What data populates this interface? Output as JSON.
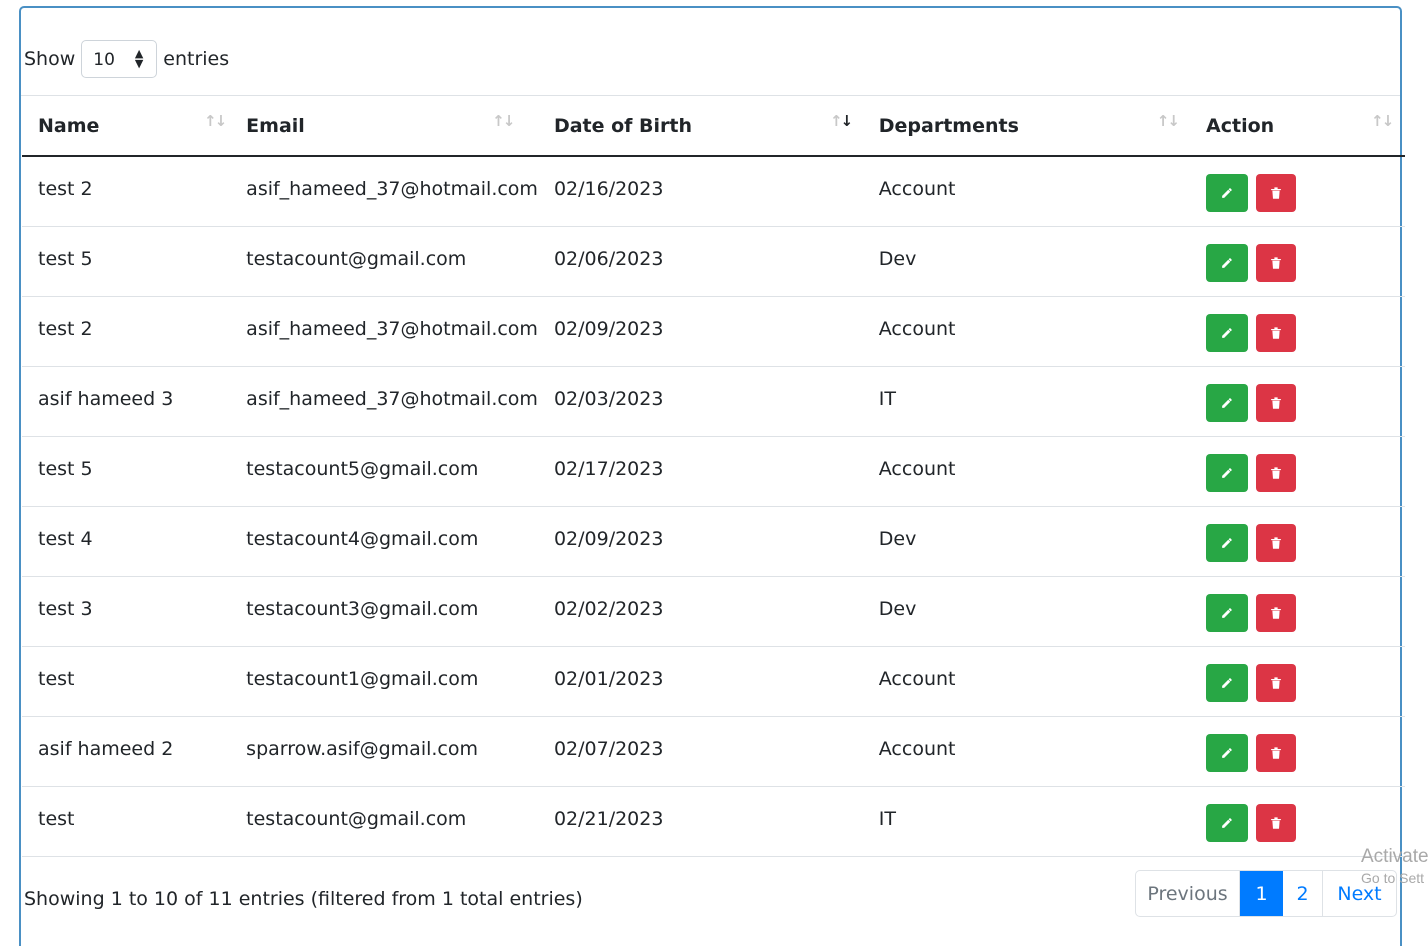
{
  "length_menu": {
    "prefix": "Show",
    "value": "10",
    "suffix": "entries"
  },
  "columns": [
    "Name",
    "Email",
    "Date of Birth",
    "Departments",
    "Action"
  ],
  "rows": [
    {
      "name": "test 2",
      "email": "asif_hameed_37@hotmail.com",
      "dob": "02/16/2023",
      "dept": "Account"
    },
    {
      "name": "test 5",
      "email": "testacount@gmail.com",
      "dob": "02/06/2023",
      "dept": "Dev"
    },
    {
      "name": "test 2",
      "email": "asif_hameed_37@hotmail.com",
      "dob": "02/09/2023",
      "dept": "Account"
    },
    {
      "name": "asif hameed 3",
      "email": "asif_hameed_37@hotmail.com",
      "dob": "02/03/2023",
      "dept": "IT"
    },
    {
      "name": "test 5",
      "email": "testacount5@gmail.com",
      "dob": "02/17/2023",
      "dept": "Account"
    },
    {
      "name": "test 4",
      "email": "testacount4@gmail.com",
      "dob": "02/09/2023",
      "dept": "Dev"
    },
    {
      "name": "test 3",
      "email": "testacount3@gmail.com",
      "dob": "02/02/2023",
      "dept": "Dev"
    },
    {
      "name": "test",
      "email": "testacount1@gmail.com",
      "dob": "02/01/2023",
      "dept": "Account"
    },
    {
      "name": "asif hameed 2",
      "email": "sparrow.asif@gmail.com",
      "dob": "02/07/2023",
      "dept": "Account"
    },
    {
      "name": "test",
      "email": "testacount@gmail.com",
      "dob": "02/21/2023",
      "dept": "IT"
    }
  ],
  "row_actions": {
    "edit_icon": "pencil-icon",
    "delete_icon": "trash-icon",
    "edit_color": "#28a745",
    "delete_color": "#dc3545"
  },
  "sort_icon": "↑↓",
  "info": "Showing 1 to 10 of 11 entries (filtered from 1 total entries)",
  "pagination": {
    "previous": "Previous",
    "pages": [
      "1",
      "2"
    ],
    "active": "1",
    "next": "Next"
  },
  "watermark": {
    "line1": "Activate",
    "line2": "Go to Sett"
  }
}
